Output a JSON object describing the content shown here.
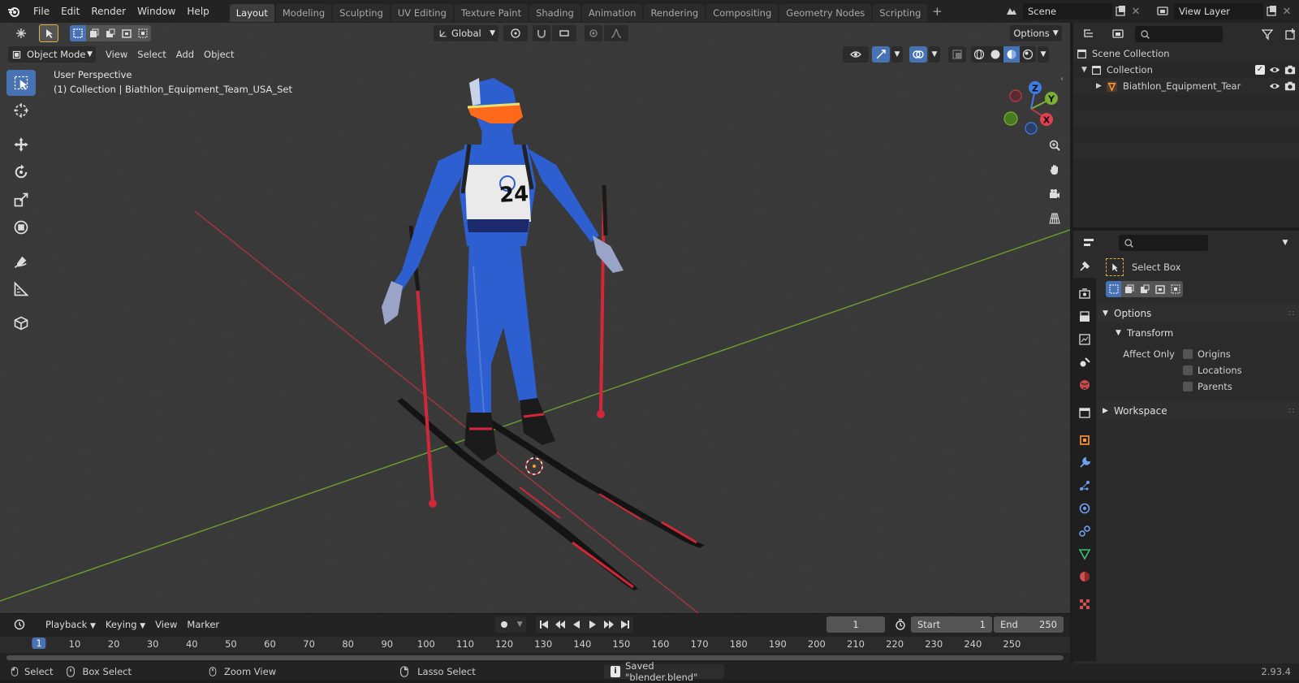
{
  "menus": [
    "File",
    "Edit",
    "Render",
    "Window",
    "Help"
  ],
  "workspaces": [
    "Layout",
    "Modeling",
    "Sculpting",
    "UV Editing",
    "Texture Paint",
    "Shading",
    "Animation",
    "Rendering",
    "Compositing",
    "Geometry Nodes",
    "Scripting"
  ],
  "active_workspace": "Layout",
  "scene": {
    "name": "Scene"
  },
  "view_layer": {
    "name": "View Layer"
  },
  "viewport": {
    "transform_orientation": "Global",
    "options_label": "Options",
    "mode": "Object Mode",
    "header_menus": [
      "View",
      "Select",
      "Add",
      "Object"
    ],
    "overlay_title": "User Perspective",
    "overlay_subtitle": "(1) Collection | Biathlon_Equipment_Team_USA_Set",
    "bib_number": "24",
    "gizmo_axes": {
      "z": "Z",
      "y": "Y",
      "x": "X"
    }
  },
  "outliner": {
    "scene_collection": "Scene Collection",
    "collection": "Collection",
    "object": "Biathlon_Equipment_Tear"
  },
  "properties": {
    "tool_name": "Select Box",
    "options_label": "Options",
    "transform_label": "Transform",
    "affect_only_label": "Affect Only",
    "affect_items": [
      "Origins",
      "Locations",
      "Parents"
    ],
    "workspace_label": "Workspace"
  },
  "timeline": {
    "menus": [
      "Playback",
      "Keying",
      "View",
      "Marker"
    ],
    "current_frame": "1",
    "start_label": "Start",
    "start": "1",
    "end_label": "End",
    "end": "250",
    "ruler": [
      "1",
      "10",
      "20",
      "30",
      "40",
      "50",
      "60",
      "70",
      "80",
      "90",
      "100",
      "110",
      "120",
      "130",
      "140",
      "150",
      "160",
      "170",
      "180",
      "190",
      "200",
      "210",
      "220",
      "230",
      "240",
      "250"
    ]
  },
  "statusbar": {
    "select": "Select",
    "box_select": "Box Select",
    "zoom_view": "Zoom View",
    "lasso_select": "Lasso Select",
    "message": "Saved \"blender.blend\"",
    "version": "2.93.4"
  },
  "colors": {
    "accent": "#4772b3",
    "axis_x": "#c0394b",
    "axis_y": "#7bb032",
    "axis_z": "#3d7ee6",
    "suit_blue": "#2d5fd0",
    "pole_red": "#d02838"
  }
}
